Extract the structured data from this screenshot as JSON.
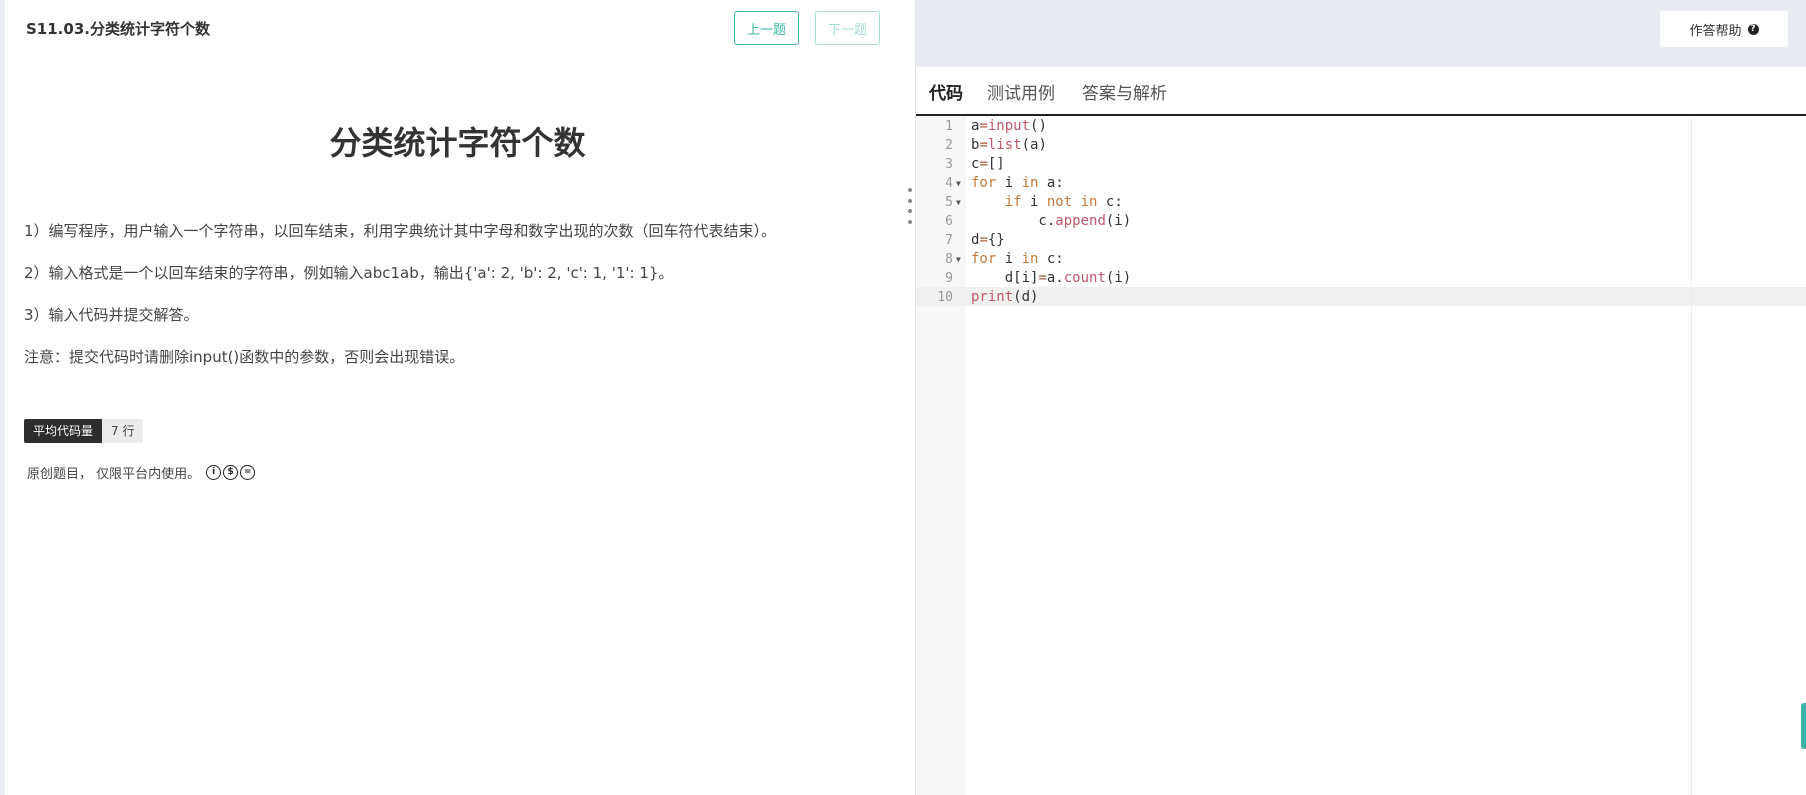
{
  "problem": {
    "code_title": "S11.03.分类统计字符个数",
    "prev_button": "上一题",
    "next_button": "下一题",
    "title": "分类统计字符个数",
    "description": [
      "1）编写程序，用户输入一个字符串，以回车结束，利用字典统计其中字母和数字出现的次数（回车符代表结束）。",
      "2）输入格式是一个以回车结束的字符串，例如输入abc1ab，输出{'a': 2, 'b': 2, 'c': 1, '1': 1}。",
      "3）输入代码并提交解答。",
      "注意：提交代码时请删除input()函数中的参数，否则会出现错误。"
    ],
    "avg_code_label": "平均代码量",
    "avg_code_value": "7 行",
    "origin_note": "原创题目， 仅限平台内使用。",
    "license_icons": [
      "cc-by-icon",
      "cc-nc-icon",
      "cc-nd-icon"
    ]
  },
  "right": {
    "help_button": "作答帮助",
    "tabs": [
      "代码",
      "测试用例",
      "答案与解析"
    ],
    "active_tab": "代码"
  },
  "editor": {
    "lines": [
      {
        "num": "1",
        "text": "a=input()"
      },
      {
        "num": "2",
        "text": "b=list(a)"
      },
      {
        "num": "3",
        "text": "c=[]"
      },
      {
        "num": "4",
        "text": "for i in a:",
        "fold": true
      },
      {
        "num": "5",
        "text": "    if i not in c:",
        "fold": true
      },
      {
        "num": "6",
        "text": "        c.append(i)"
      },
      {
        "num": "7",
        "text": "d={}"
      },
      {
        "num": "8",
        "text": "for i in c:",
        "fold": true
      },
      {
        "num": "9",
        "text": "    d[i]=a.count(i)"
      },
      {
        "num": "10",
        "text": "print(d)"
      }
    ],
    "active_line": "10"
  },
  "colors": {
    "accent": "#3bb4a6",
    "keyword": "#c6793a",
    "builtin": "#c05a6b"
  }
}
